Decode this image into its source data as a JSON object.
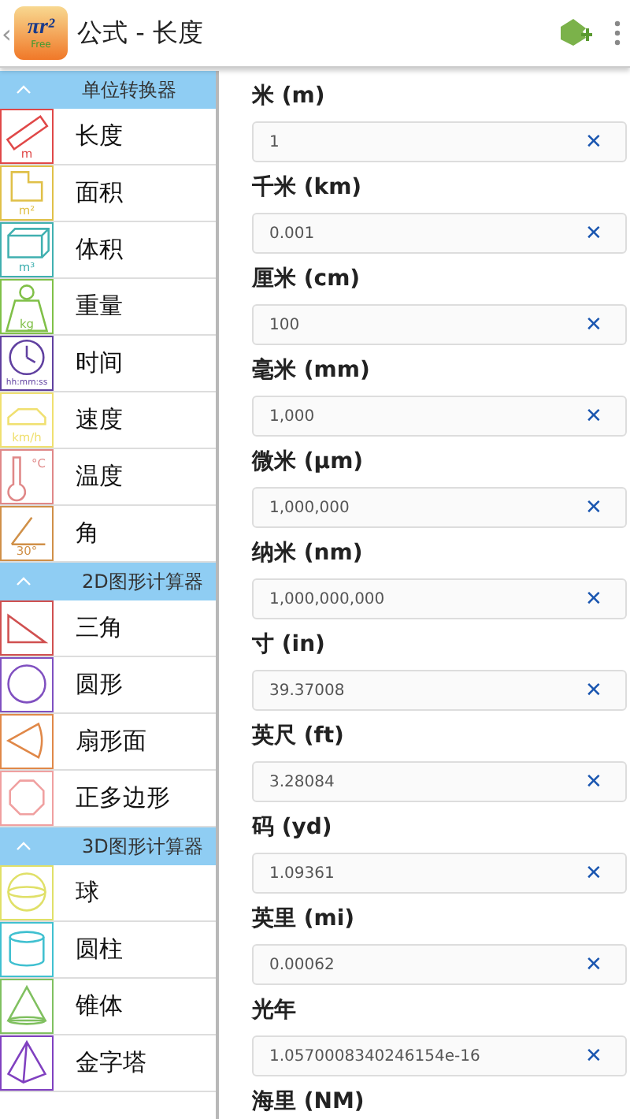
{
  "app_bar": {
    "back": "‹",
    "logo": {
      "formula": "πr²",
      "badge": "Free"
    },
    "title": "公式 - 长度"
  },
  "sidebar": [
    {
      "title": "单位转换器",
      "expanded": true,
      "items": [
        {
          "label": "长度",
          "kind": "ruler",
          "color": "#e04848",
          "icon_text": "m"
        },
        {
          "label": "面积",
          "kind": "area",
          "color": "#e0c048",
          "icon_text": "m²"
        },
        {
          "label": "体积",
          "kind": "volume",
          "color": "#40b0b0",
          "icon_text": "m³"
        },
        {
          "label": "重量",
          "kind": "weight",
          "color": "#80c048",
          "icon_text": "kg"
        },
        {
          "label": "时间",
          "kind": "clock",
          "color": "#6040a0",
          "icon_text": "hh:mm:ss"
        },
        {
          "label": "速度",
          "kind": "car",
          "color": "#f0e070",
          "icon_text": "km/h"
        },
        {
          "label": "温度",
          "kind": "thermometer",
          "color": "#e08888",
          "icon_text": "°C"
        },
        {
          "label": "角",
          "kind": "angle",
          "color": "#d09048",
          "icon_text": "30°"
        }
      ]
    },
    {
      "title": "2D图形计算器",
      "expanded": true,
      "items": [
        {
          "label": "三角",
          "kind": "triangle",
          "color": "#d05050"
        },
        {
          "label": "圆形",
          "kind": "circle",
          "color": "#8050c0"
        },
        {
          "label": "扇形面",
          "kind": "sector",
          "color": "#e08848"
        },
        {
          "label": "正多边形",
          "kind": "octagon",
          "color": "#f0a0a0"
        }
      ]
    },
    {
      "title": "3D图形计算器",
      "expanded": true,
      "items": [
        {
          "label": "球",
          "kind": "sphere",
          "color": "#e0e068"
        },
        {
          "label": "圆柱",
          "kind": "cylinder",
          "color": "#40c0d0"
        },
        {
          "label": "锥体",
          "kind": "cone",
          "color": "#80c060"
        },
        {
          "label": "金字塔",
          "kind": "pyramid",
          "color": "#8040c0"
        }
      ]
    }
  ],
  "units": [
    {
      "label": "米 (m)",
      "value": "1"
    },
    {
      "label": "千米 (km)",
      "value": "0.001"
    },
    {
      "label": "厘米 (cm)",
      "value": "100"
    },
    {
      "label": "毫米 (mm)",
      "value": "1,000"
    },
    {
      "label": "微米 (µm)",
      "value": "1,000,000"
    },
    {
      "label": "纳米 (nm)",
      "value": "1,000,000,000"
    },
    {
      "label": "寸 (in)",
      "value": "39.37008"
    },
    {
      "label": "英尺 (ft)",
      "value": "3.28084"
    },
    {
      "label": "码 (yd)",
      "value": "1.09361"
    },
    {
      "label": "英里 (mi)",
      "value": "0.00062"
    },
    {
      "label": "光年",
      "value": "1.0570008340246154e-16"
    },
    {
      "label": "海里 (NM)"
    }
  ],
  "clear_glyph": "✕"
}
